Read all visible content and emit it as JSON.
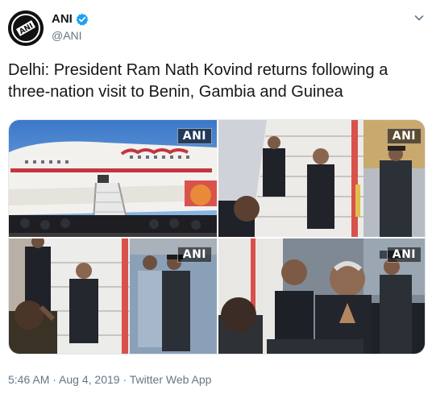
{
  "author": {
    "display_name": "ANI",
    "handle": "@ANI",
    "avatar_icon": "ani-logo-icon",
    "verified_icon": "verified-badge-icon"
  },
  "menu_icon": "chevron-down-icon",
  "tweet": {
    "text": "Delhi: President Ram Nath Kovind returns following a three-nation visit to Benin, Gambia and Guinea"
  },
  "media": {
    "badges": [
      "ANI",
      "ANI",
      "ANI",
      "ANI"
    ]
  },
  "footer": {
    "time": "5:46 AM",
    "separator_1": " · ",
    "date": "Aug 4, 2019",
    "separator_2": " · ",
    "source": "Twitter Web App"
  },
  "colors": {
    "text": "#14171a",
    "muted": "#657786",
    "verified": "#1da1f2"
  }
}
